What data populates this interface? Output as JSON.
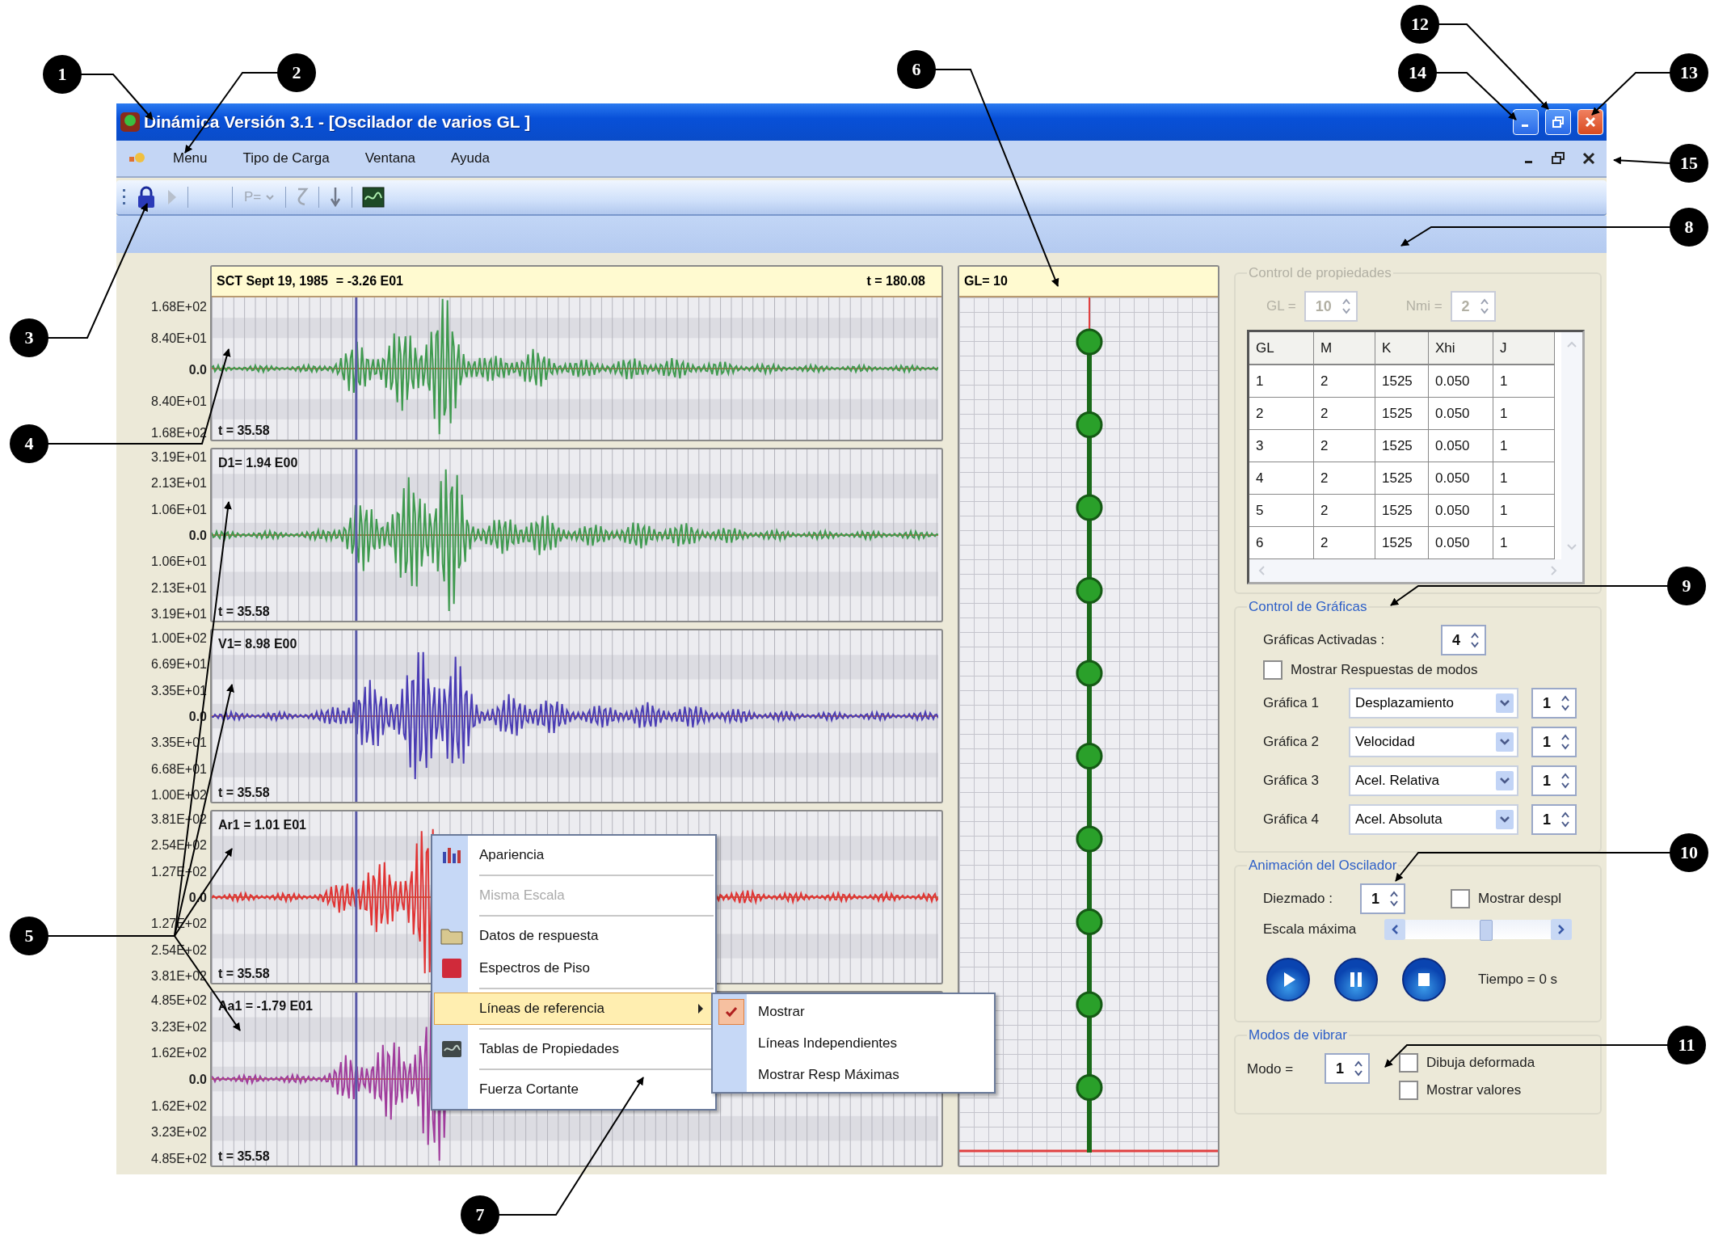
{
  "window": {
    "title": "Dinámica Versión  3.1 - [Oscilador de varios GL ]"
  },
  "menu": [
    {
      "label": "Menu"
    },
    {
      "label": "Tipo de Carga"
    },
    {
      "label": "Ventana"
    },
    {
      "label": "Ayuda"
    }
  ],
  "toolbar": {
    "load_label": "P="
  },
  "charts": [
    {
      "header": {
        "title": "SCT Sept 19, 1985",
        "value": "= -3.26 E01",
        "duration": "t = 180.08"
      },
      "time": "t = 35.58",
      "color": "#3f9a4f",
      "yticks": [
        "1.68E+02",
        "8.40E+01",
        "0.0",
        "8.40E+01",
        "1.68E+02"
      ]
    },
    {
      "label": "D1= 1.94 E00",
      "time": "t = 35.58",
      "color": "#3f9a4f",
      "yticks": [
        "3.19E+01",
        "2.13E+01",
        "1.06E+01",
        "0.0",
        "1.06E+01",
        "2.13E+01",
        "3.19E+01"
      ]
    },
    {
      "label": "V1= 8.98 E00",
      "time": "t = 35.58",
      "color": "#4a3cb4",
      "yticks": [
        "1.00E+02",
        "6.69E+01",
        "3.35E+01",
        "0.0",
        "3.35E+01",
        "6.68E+01",
        "1.00E+02"
      ]
    },
    {
      "label": "Ar1 = 1.01 E01",
      "time": "t = 35.58",
      "color": "#e03434",
      "yticks": [
        "3.81E+02",
        "2.54E+02",
        "1.27E+02",
        "0.0",
        "1.27E+02",
        "2.54E+02",
        "3.81E+02"
      ]
    },
    {
      "label": "Aa1 = -1.79 E01",
      "time": "t = 35.58",
      "color": "#a03c9c",
      "yticks": [
        "4.85E+02",
        "3.23E+02",
        "1.62E+02",
        "0.0",
        "1.62E+02",
        "3.23E+02",
        "4.85E+02"
      ]
    }
  ],
  "oscillator": {
    "title": "GL= 10"
  },
  "context_menu": [
    {
      "label": "Apariencia",
      "disabled": false,
      "selected": false,
      "submenu": false,
      "divider_below": true
    },
    {
      "label": "Misma Escala",
      "disabled": true,
      "selected": false,
      "submenu": false,
      "divider_below": true
    },
    {
      "label": "Datos de respuesta",
      "disabled": false,
      "selected": false,
      "submenu": false,
      "divider_below": false
    },
    {
      "label": "Espectros de Piso",
      "disabled": false,
      "selected": false,
      "submenu": false,
      "divider_below": true
    },
    {
      "label": "Líneas de referencia",
      "disabled": false,
      "selected": true,
      "submenu": true,
      "divider_below": true
    },
    {
      "label": "Tablas de Propiedades",
      "disabled": false,
      "selected": false,
      "submenu": false,
      "divider_below": true
    },
    {
      "label": "Fuerza Cortante",
      "disabled": false,
      "selected": false,
      "submenu": false,
      "divider_below": false
    }
  ],
  "submenu": [
    {
      "label": "Mostrar",
      "checked": true
    },
    {
      "label": "Líneas Independientes",
      "checked": false
    },
    {
      "label": "Mostrar Resp Máximas",
      "checked": false
    }
  ],
  "properties": {
    "title": "Control de propiedades",
    "disabled": true,
    "gl_label": "GL =",
    "gl_value": "10",
    "nmi_label": "Nmi =",
    "nmi_value": "2",
    "columns": [
      "GL",
      "M",
      "K",
      "Xhi",
      "J"
    ],
    "rows": [
      [
        "1",
        "2",
        "1525",
        "0.050",
        "1"
      ],
      [
        "2",
        "2",
        "1525",
        "0.050",
        "1"
      ],
      [
        "3",
        "2",
        "1525",
        "0.050",
        "1"
      ],
      [
        "4",
        "2",
        "1525",
        "0.050",
        "1"
      ],
      [
        "5",
        "2",
        "1525",
        "0.050",
        "1"
      ],
      [
        "6",
        "2",
        "1525",
        "0.050",
        "1"
      ]
    ]
  },
  "graphs": {
    "title": "Control de Gráficas",
    "active_label": "Gráficas Activadas :",
    "active_value": "4",
    "show_modes": {
      "label": "Mostrar Respuestas de modos",
      "checked": false
    },
    "rows": [
      {
        "label": "Gráfica 1",
        "value": "Desplazamiento",
        "mode": "1"
      },
      {
        "label": "Gráfica 2",
        "value": "Velocidad",
        "mode": "1"
      },
      {
        "label": "Gráfica 3",
        "value": "Acel. Relativa",
        "mode": "1"
      },
      {
        "label": "Gráfica 4",
        "value": "Acel. Absoluta",
        "mode": "1"
      }
    ]
  },
  "animation": {
    "title": "Animación del Oscilador",
    "decimation_label": "Diezmado :",
    "decimation_value": "1",
    "show_disp": {
      "label": "Mostrar despl",
      "checked": false
    },
    "scale_label": "Escala máxima",
    "scale": {
      "level": 0.55
    },
    "time": "Tiempo = 0 s"
  },
  "modes": {
    "title": "Modos de vibrar",
    "mode_label": "Modo =",
    "mode_value": "1",
    "options": [
      {
        "label": "Dibuja deformada",
        "checked": false
      },
      {
        "label": "Mostrar valores",
        "checked": false
      }
    ]
  },
  "callouts": [
    {
      "number": "12"
    },
    {
      "number": "1"
    },
    {
      "number": "2"
    },
    {
      "number": "6"
    },
    {
      "number": "14"
    },
    {
      "number": "13"
    },
    {
      "number": "15"
    },
    {
      "number": "8"
    },
    {
      "number": "3"
    },
    {
      "number": "4"
    },
    {
      "number": "9"
    },
    {
      "number": "10"
    },
    {
      "number": "5"
    },
    {
      "number": "11"
    },
    {
      "number": "7"
    }
  ]
}
